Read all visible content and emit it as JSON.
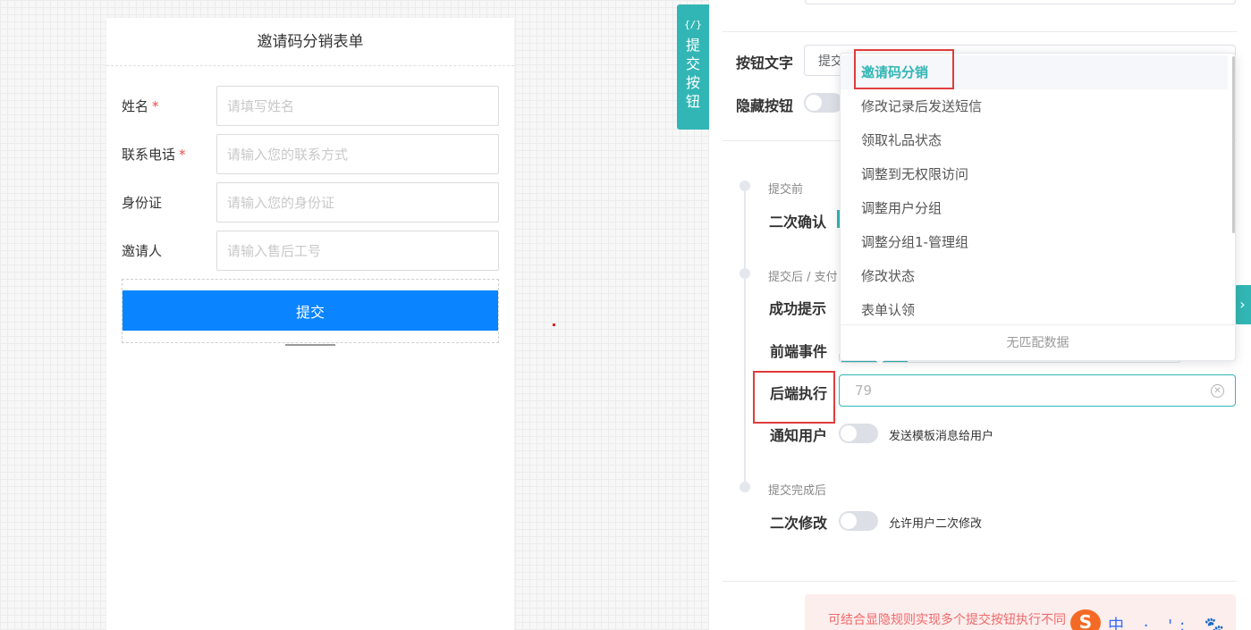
{
  "form": {
    "title": "邀请码分销表单",
    "required_mark": "*",
    "fields": [
      {
        "label": "姓名",
        "required": true,
        "placeholder": "请填写姓名"
      },
      {
        "label": "联系电话",
        "required": true,
        "placeholder": "请输入您的联系方式"
      },
      {
        "label": "身份证",
        "required": false,
        "placeholder": "请输入您的身份证"
      },
      {
        "label": "邀请人",
        "required": false,
        "placeholder": "请输入售后工号"
      }
    ],
    "submit_label": "提交"
  },
  "side_tab": {
    "code": "{/}",
    "label": "提交按钮"
  },
  "panel": {
    "button_text_label": "按钮文字",
    "button_text_value": "提交",
    "hide_button_label": "隐藏按钮",
    "timeline": {
      "before_title": "提交前",
      "second_confirm_label": "二次确认",
      "after_title": "提交后 / 支付",
      "success_tip_label": "成功提示",
      "frontend_event_label": "前端事件",
      "backend_exec_label": "后端执行",
      "backend_exec_value": "79",
      "notify_user_label": "通知用户",
      "notify_user_text": "发送模板消息给用户",
      "done_title": "提交完成后",
      "second_edit_label": "二次修改",
      "second_edit_text": "允许用户二次修改"
    },
    "tip_text": "可结合显隐规则实现多个提交按钮执行不同",
    "sogou_letter": "S",
    "sogou_marks": "中 · ': 🐾"
  },
  "dropdown": {
    "options": [
      "邀请码分销",
      "修改记录后发送短信",
      "领取礼品状态",
      "调整到无权限访问",
      "调整用户分组",
      "调整分组1-管理组",
      "修改状态",
      "表单认领"
    ],
    "selected_index": 0,
    "empty_text": "无匹配数据"
  },
  "colors": {
    "accent": "#32b6b5",
    "primary_button": "#0a84ff",
    "highlight": "#e03c3c",
    "required": "#f04848"
  }
}
